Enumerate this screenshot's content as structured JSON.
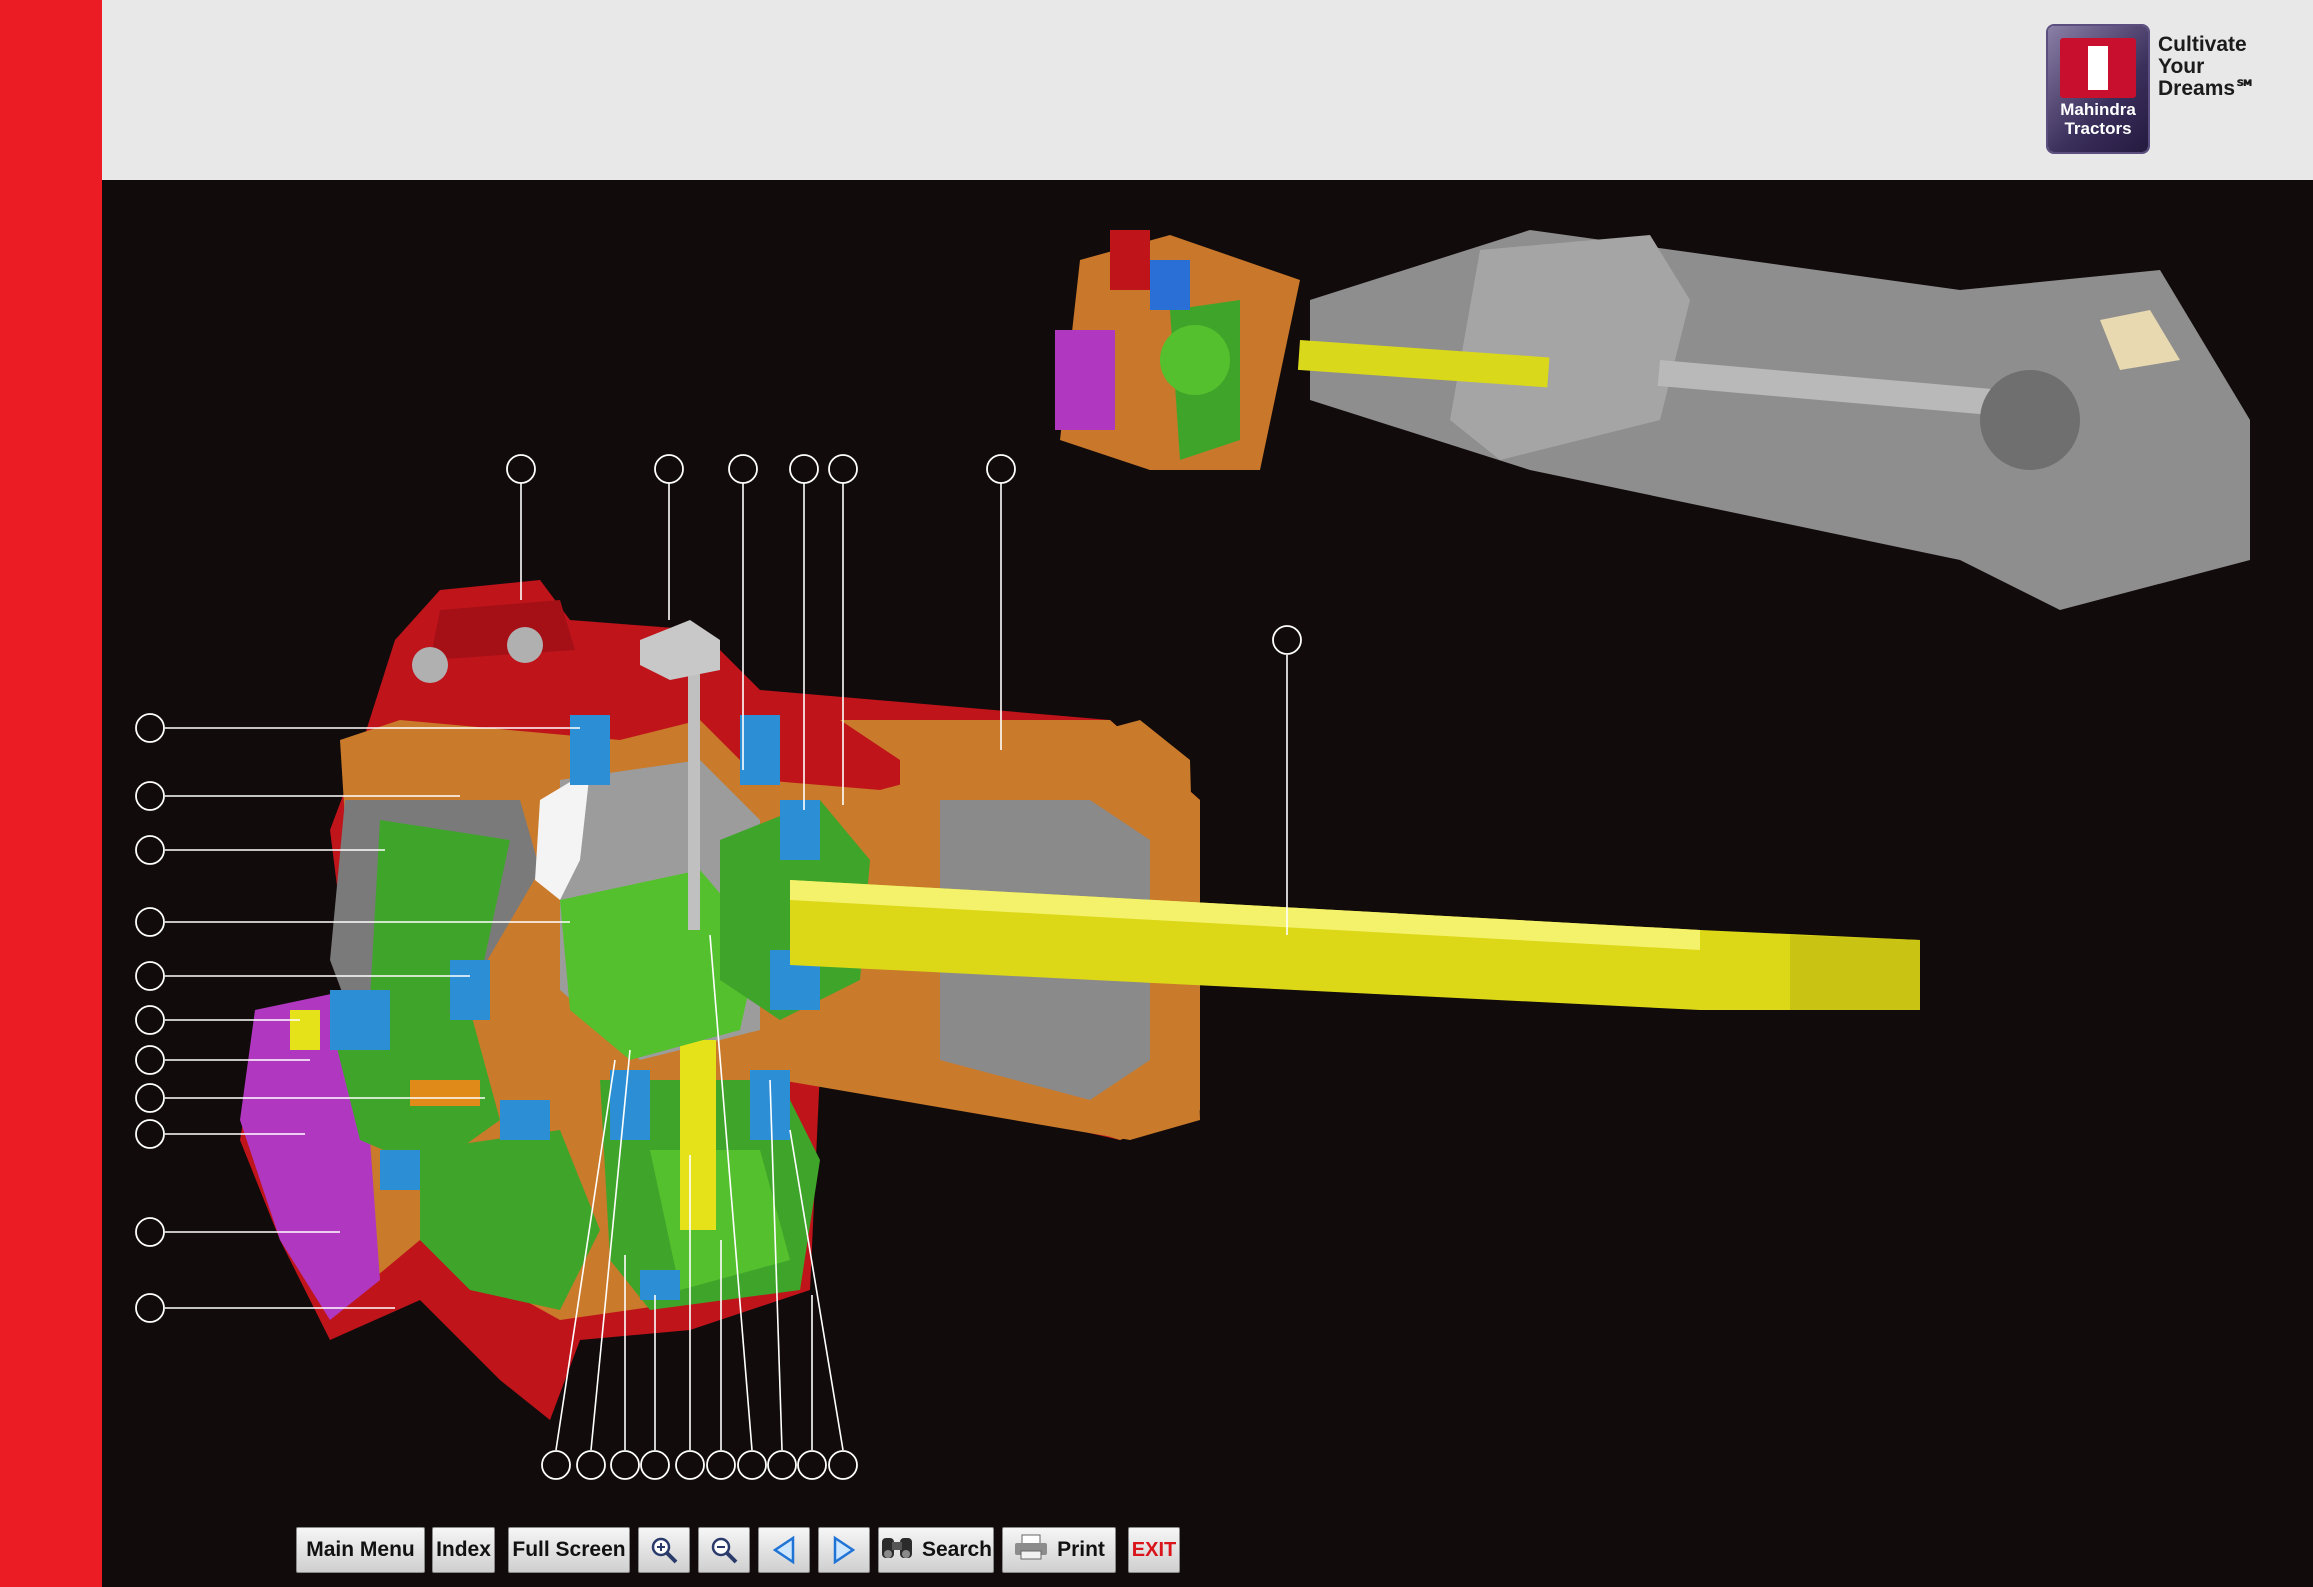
{
  "branding": {
    "logo_text": "Mahindra\nTractors",
    "tagline": "Cultivate\nYour\nDreams℠"
  },
  "toolbar": {
    "main_menu": "Main Menu",
    "index": "Index",
    "full_screen": "Full Screen",
    "zoom_in_icon": "magnifier-plus-icon",
    "zoom_out_icon": "magnifier-minus-icon",
    "prev_icon": "triangle-left-icon",
    "next_icon": "triangle-right-icon",
    "search": "Search",
    "print": "Print",
    "exit": "EXIT"
  },
  "colors": {
    "side_strip": "#ec1c24",
    "header_bg": "#e8e8e8",
    "canvas_bg": "#120b0c",
    "housing_red": "#c0141b",
    "cast_orange": "#c97a2a",
    "gear_green": "#4caf2a",
    "shaft_yellow": "#e6e21a",
    "cover_purple": "#b03ac0",
    "seal_blue": "#2c8fd6",
    "steel_grey": "#9a9a9a"
  },
  "diagram": {
    "callout_count": 30
  }
}
